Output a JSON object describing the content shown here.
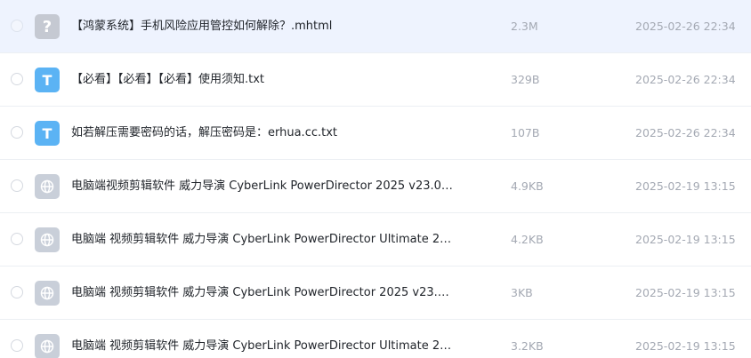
{
  "files": [
    {
      "icon": "unknown",
      "glyph": "?",
      "name": "【鸿蒙系统】手机风险应用管控如何解除？.mhtml",
      "size": "2.3M",
      "date": "2025-02-26 22:34",
      "highlighted": true
    },
    {
      "icon": "txt",
      "glyph": "T",
      "name": "【必看】【必看】【必看】使用须知.txt",
      "size": "329B",
      "date": "2025-02-26 22:34",
      "highlighted": false
    },
    {
      "icon": "txt",
      "glyph": "T",
      "name": "如若解压需要密码的话，解压密码是：erhua.cc.txt",
      "size": "107B",
      "date": "2025-02-26 22:34",
      "highlighted": false
    },
    {
      "icon": "web",
      "glyph": "",
      "name": "电脑端视频剪辑软件 威力导演 CyberLink PowerDirector 2025 v23.0…",
      "size": "4.9KB",
      "date": "2025-02-19 13:15",
      "highlighted": false
    },
    {
      "icon": "web",
      "glyph": "",
      "name": "电脑端 视频剪辑软件 威力导演 CyberLink PowerDirector Ultimate 2…",
      "size": "4.2KB",
      "date": "2025-02-19 13:15",
      "highlighted": false
    },
    {
      "icon": "web",
      "glyph": "",
      "name": "电脑端 视频剪辑软件 威力导演 CyberLink PowerDirector 2025 v23.…",
      "size": "3KB",
      "date": "2025-02-19 13:15",
      "highlighted": false
    },
    {
      "icon": "web",
      "glyph": "",
      "name": "电脑端 视频剪辑软件 威力导演 CyberLink PowerDirector Ultimate 2…",
      "size": "3.2KB",
      "date": "2025-02-19 13:15",
      "highlighted": false
    }
  ]
}
